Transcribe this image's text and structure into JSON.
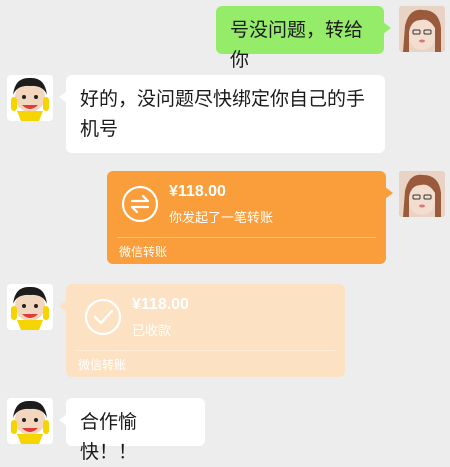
{
  "messages": {
    "m1": {
      "sender": "self",
      "text": "号没问题，转给你"
    },
    "m2": {
      "sender": "other",
      "line1": "好的，没问题尽快绑定你自己的手",
      "line2": "机号"
    },
    "m3": {
      "sender": "self",
      "amount": "¥118.00",
      "desc": "你发起了一笔转账",
      "footer": "微信转账",
      "icon": "transfer-arrows-icon"
    },
    "m4": {
      "sender": "other",
      "amount": "¥118.00",
      "desc": "已收款",
      "footer": "微信转账",
      "icon": "check-circle-icon"
    },
    "m5": {
      "sender": "other",
      "text": "合作愉快！！"
    }
  },
  "colors": {
    "background": "#ededed",
    "self_bubble": "#95ec69",
    "other_bubble": "#ffffff",
    "transfer_sent": "#fa9d3b",
    "transfer_received": "#fde1c3"
  }
}
